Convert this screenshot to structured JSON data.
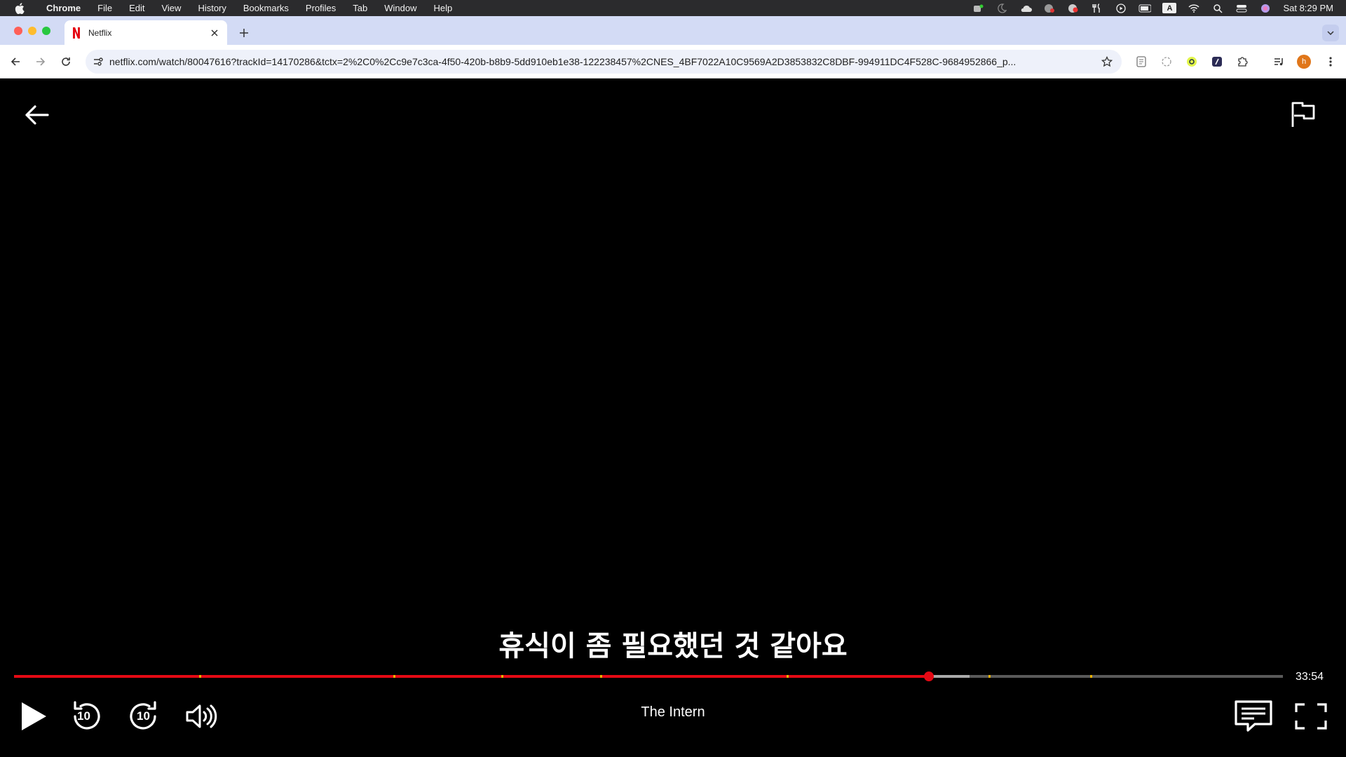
{
  "menubar": {
    "app": "Chrome",
    "items": [
      "File",
      "Edit",
      "View",
      "History",
      "Bookmarks",
      "Profiles",
      "Tab",
      "Window",
      "Help"
    ],
    "clock": "Sat 8:29 PM",
    "keyboard_indicator": "A"
  },
  "browser": {
    "tab_title": "Netflix",
    "url": "netflix.com/watch/80047616?trackId=14170286&tctx=2%2C0%2Cc9e7c3ca-4f50-420b-b8b9-5dd910eb1e38-122238457%2CNES_4BF7022A10C9569A2D3853832C8DBF-994911DC4F528C-9684952866_p...",
    "profile_initial": "h"
  },
  "player": {
    "subtitle": "휴식이 좀 필요했던 것 같아요",
    "title": "The Intern",
    "time_remaining": "33:54",
    "progress": 0.721,
    "buffered": 0.753,
    "chapter_ticks": [
      0.146,
      0.299,
      0.384,
      0.462,
      0.609,
      0.768,
      0.848
    ],
    "rewind_seconds": "10",
    "forward_seconds": "10"
  },
  "colors": {
    "netflix_red": "#e50914",
    "tick_yellow": "#e8b100",
    "tabstrip": "#d3dbf5"
  }
}
